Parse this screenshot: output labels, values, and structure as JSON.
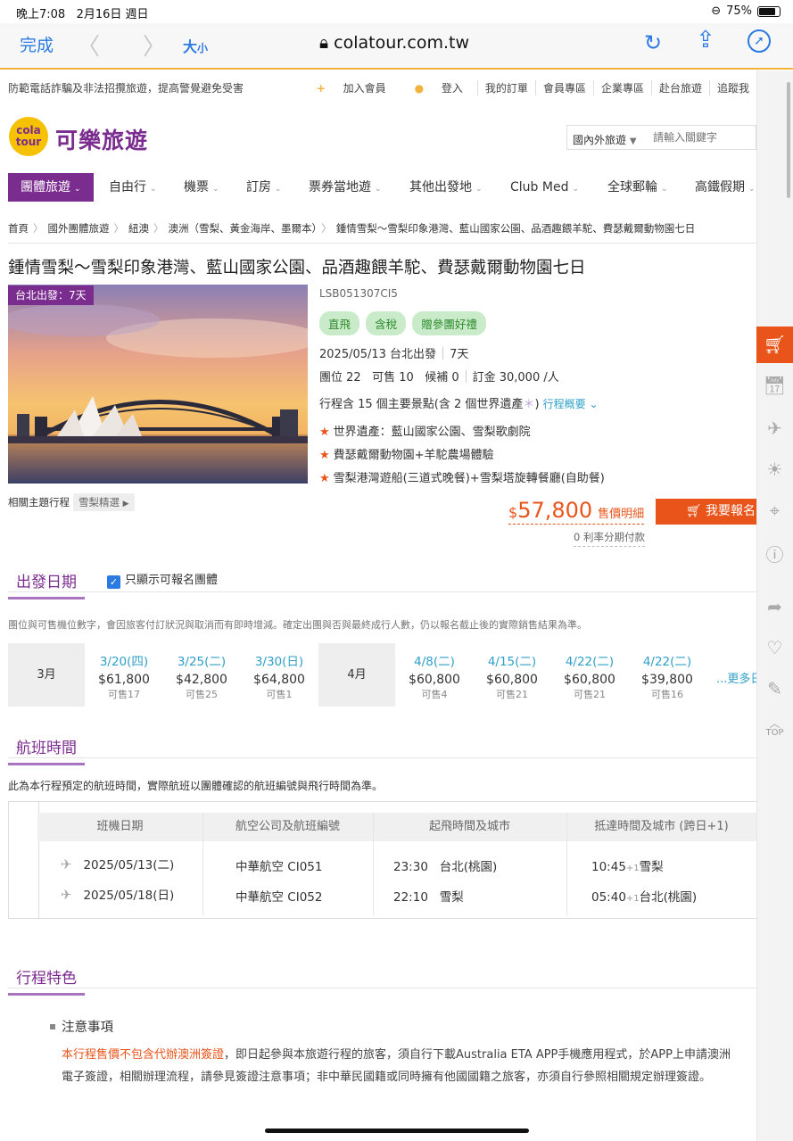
{
  "status": {
    "time": "晚上7:08",
    "date": "2月16日 週日",
    "battery": "75%"
  },
  "browser": {
    "done": "完成",
    "font_big": "大",
    "font_small": "小",
    "url": "colatour.com.tw"
  },
  "util": {
    "warning": "防範電話詐騙及非法招攬旅遊，提高警覺避免受害",
    "join": "加入會員",
    "login": "登入",
    "orders": "我的訂單",
    "member": "會員專區",
    "corporate": "企業專區",
    "taiwan": "赴台旅遊",
    "track": "追蹤我"
  },
  "logo": {
    "mark_line1": "cola",
    "mark_line2": "tour",
    "name": "可樂旅遊"
  },
  "search": {
    "select": "國內外旅遊",
    "placeholder": "請輸入關鍵字"
  },
  "nav": [
    "團體旅遊",
    "自由行",
    "機票",
    "訂房",
    "票券當地遊",
    "其他出發地",
    "Club Med",
    "全球郵輪",
    "高鐵假期"
  ],
  "breadcrumb": [
    "首頁",
    "國外團體旅遊",
    "紐澳",
    "澳洲（雪梨、黃金海岸、墨爾本）",
    "鍾情雪梨～雪梨印象港灣、藍山國家公園、品酒趣餵羊駝、費瑟戴爾動物園七日"
  ],
  "tour": {
    "title": "鍾情雪梨～雪梨印象港灣、藍山國家公園、品酒趣餵羊駝、費瑟戴爾動物園七日",
    "hero_tag": "台北出發：7天",
    "code": "LSB051307CI5",
    "badges": [
      "直飛",
      "含稅",
      "贈參團好禮"
    ],
    "depart": "2025/05/13 台北出發",
    "days": "7天",
    "seats": "團位 22",
    "available": "可售 10",
    "waitlist": "候補 0",
    "deposit": "訂金 30,000 /人",
    "spots": "行程含 15 個主要景點(含 2 個世界遺產",
    "overview": "行程概要",
    "highlights": [
      "世界遺產：藍山國家公園、雪梨歌劇院",
      "費瑟戴爾動物園+羊駝農場體驗",
      "雪梨港灣遊船(三道式晚餐)+雪梨塔旋轉餐廳(自助餐)"
    ],
    "related_label": "相關主題行程",
    "related_tag": "雪梨精選",
    "price_symbol": "$",
    "price": "57,800",
    "price_detail": "售價明細",
    "book": "我要報名",
    "installment": "0 利率分期付款"
  },
  "departures": {
    "heading": "出發日期",
    "only_open": "只顯示可報名團體",
    "note": "團位與可售機位數字，會因旅客付訂狀況與取消而有即時增減。確定出團與否與最終成行人數，仍以報名截止後的實際銷售結果為準。",
    "months": [
      "3月",
      "4月"
    ],
    "dates": [
      {
        "d": "3/20(四)",
        "p": "$61,800",
        "s": "可售17"
      },
      {
        "d": "3/25(二)",
        "p": "$42,800",
        "s": "可售25"
      },
      {
        "d": "3/30(日)",
        "p": "$64,800",
        "s": "可售1"
      },
      {
        "d": "4/8(二)",
        "p": "$60,800",
        "s": "可售4"
      },
      {
        "d": "4/15(二)",
        "p": "$60,800",
        "s": "可售21"
      },
      {
        "d": "4/22(二)",
        "p": "$60,800",
        "s": "可售21"
      },
      {
        "d": "4/22(二)",
        "p": "$39,800",
        "s": "可售16"
      }
    ],
    "more": "...更多日"
  },
  "flights": {
    "heading": "航班時間",
    "note": "此為本行程預定的航班時間，實際航班以團體確認的航班編號與飛行時間為準。",
    "headers": [
      "班機日期",
      "航空公司及航班編號",
      "起飛時間及城市",
      "抵達時間及城市 (跨日+1)"
    ],
    "rows": [
      {
        "date": "2025/05/13(二)",
        "flight": "中華航空  CI051",
        "dep_time": "23:30",
        "dep_city": "台北(桃園)",
        "arr_time": "10:45",
        "plus": "+1",
        "arr_city": "雪梨"
      },
      {
        "date": "2025/05/18(日)",
        "flight": "中華航空  CI052",
        "dep_time": "22:10",
        "dep_city": "雪梨",
        "arr_time": "05:40",
        "plus": "+1",
        "arr_city": "台北(桃園)"
      }
    ]
  },
  "features": {
    "heading": "行程特色",
    "notice_title": "注意事項",
    "notice_highlight": "本行程售價不包含代辦澳洲簽證",
    "notice_rest": "，即日起參與本旅遊行程的旅客，須自行下載Australia ETA APP手機應用程式，於APP上申請澳洲電子簽證，相關辦理流程，請參見簽證注意事項；非中華民國籍或同時擁有他國國籍之旅客，亦須自行參照相關規定辦理簽證。"
  },
  "sidebar": {
    "top": "TOP"
  },
  "colors": {
    "brand": "#7b2c8f",
    "accent": "#e8541a",
    "link": "#2fa0c8",
    "badge": "#c9ebc9"
  }
}
